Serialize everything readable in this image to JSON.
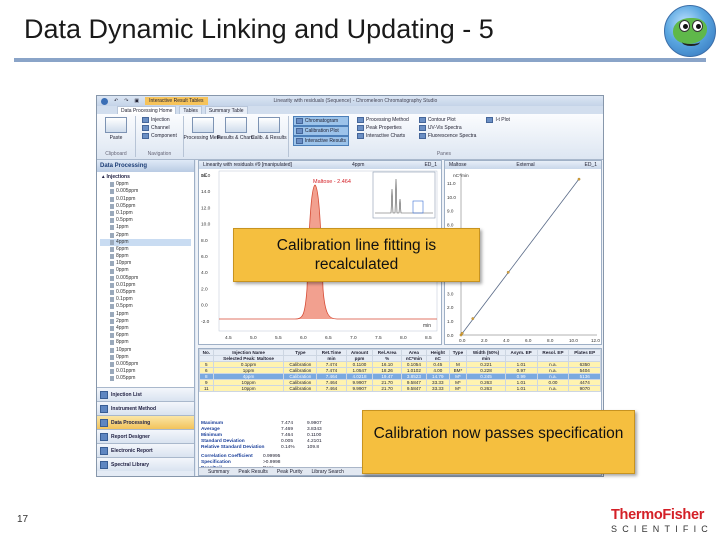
{
  "slide": {
    "title": "Data Dynamic Linking and Updating - 5",
    "number": "17",
    "accent_color": "#8aa4c8",
    "logo_line1": "ThermoFisher",
    "logo_line2": "SCIENTIFIC"
  },
  "callouts": {
    "one": "Calibration line fitting is recalculated",
    "two": "Calibration now passes specification"
  },
  "app": {
    "context_tab": "Interactive Result Tables",
    "window_title": "Linearity with residuals (Sequence) - Chromeleon Chromatography Studio",
    "tabs": [
      "Data Processing Home",
      "Tables",
      "Summary Table"
    ],
    "ribbon": {
      "clipboard_label": "Clipboard",
      "paste": "Paste",
      "navigation_label": "Navigation",
      "nav_items": [
        "Injection",
        "Channel",
        "Component"
      ],
      "panes_label": "Panes",
      "layouts": [
        "Processing Meth.",
        "Results & Charts",
        "Calib. & Results"
      ],
      "views": [
        "Chromatogram",
        "Calibration Plot",
        "Interactive Results"
      ],
      "views2": [
        "Processing Method",
        "Peak Properties",
        "Interactive Charts"
      ],
      "views3": [
        "Contour Plot",
        "UV-Vis Spectra",
        "Fluorescence Spectra"
      ],
      "views4": [
        "I-t Plot"
      ]
    },
    "sidebar": {
      "header": "Data Processing",
      "injections_label": "Injections",
      "injections": [
        "0ppm",
        "0.005ppm",
        "0.01ppm",
        "0.05ppm",
        "0.1ppm",
        "0.5ppm",
        "1ppm",
        "2ppm",
        "4ppm",
        "6ppm",
        "8ppm",
        "10ppm",
        "0ppm",
        "0.005ppm",
        "0.01ppm",
        "0.05ppm",
        "0.1ppm",
        "0.5ppm",
        "1ppm",
        "2ppm",
        "4ppm",
        "6ppm",
        "8ppm",
        "10ppm",
        "0ppm",
        "0.005ppm",
        "0.01ppm",
        "0.05ppm"
      ],
      "selected_index": 8,
      "nav_buttons": [
        "Injection List",
        "Instrument Method",
        "Data Processing",
        "Report Designer",
        "Electronic Report",
        "Spectral Library"
      ],
      "active_nav": 2
    },
    "chromatogram": {
      "title": "Linearity with residuals #9 [manipulated]",
      "injection": "4ppm",
      "channel": "ED_1",
      "unit": "nC",
      "peak_label": "Maltose - 2.464",
      "x_ticks": [
        "4.5",
        "5.0",
        "5.5",
        "6.0",
        "6.5",
        "7.0",
        "7.5",
        "8.0",
        "8.5"
      ],
      "y_ticks": [
        "16.0",
        "14.0",
        "12.0",
        "10.0",
        "8.0",
        "6.0",
        "4.0",
        "2.0",
        "0.0",
        "-2.0"
      ],
      "x_unit": "min"
    },
    "calibration": {
      "title": "Maltose",
      "mode": "External",
      "channel": "ED_1",
      "y_unit": "nC*min",
      "x_ticks": [
        "0.0",
        "2.0",
        "4.0",
        "6.0",
        "8.0",
        "10.0",
        "12.0"
      ],
      "y_ticks": [
        "11.0",
        "10.0",
        "9.0",
        "8.0",
        "7.0",
        "6.0",
        "5.0",
        "4.0",
        "3.0",
        "2.0",
        "1.0",
        "0.0"
      ]
    },
    "results": {
      "columns": [
        "No.",
        "Injection Name",
        "Type",
        "Ret.Time",
        "Amount",
        "Rel.Area",
        "Area",
        "Height",
        "Type",
        "Width (50%)",
        "Asym. EP",
        "Resol. EP",
        "Plates EP"
      ],
      "sub": [
        "",
        "Selected Peak: Maltose",
        "",
        "min",
        "ppm",
        "%",
        "nC*min",
        "nC",
        "",
        "min",
        "",
        "",
        ""
      ],
      "rows": [
        [
          "5",
          "0.1ppm",
          "Calibration",
          "7.474",
          "0.1100",
          "16.10",
          "0.1054",
          "0.45",
          "M",
          "0.221",
          "1.01",
          "n.a.",
          "6350"
        ],
        [
          "6",
          "1ppm",
          "Calibration",
          "7.474",
          "1.0547",
          "18.26",
          "1.0102",
          "4.00",
          "BM*",
          "0.228",
          "0.97",
          "n.a.",
          "5404"
        ],
        [
          "8",
          "4ppm",
          "Calibration",
          "7.464",
          "4.0218",
          "19.47",
          "3.8523",
          "14.79",
          "M*",
          "0.245",
          "0.99",
          "n.a.",
          "5136"
        ],
        [
          "9",
          "10ppm",
          "Calibration",
          "7.464",
          "9.9907",
          "21.70",
          "9.5847",
          "33.33",
          "M*",
          "0.263",
          "1.01",
          "0.00",
          "4474"
        ],
        [
          "11",
          "10ppm",
          "Calibration",
          "7.464",
          "9.9907",
          "21.70",
          "9.5847",
          "33.33",
          "M*",
          "0.263",
          "1.01",
          "n.a.",
          "9070"
        ]
      ],
      "stats_rows": [
        [
          "Maximum",
          "7.474",
          "9.9907"
        ],
        [
          "Average",
          "7.469",
          "3.8343"
        ],
        [
          "Minimum",
          "7.464",
          "0.1100"
        ],
        [
          "Standard Deviation",
          "0.005",
          "4.2101"
        ],
        [
          "Relative Standard Deviation",
          "0.14%",
          "109.8"
        ]
      ],
      "correlation_label": "Correlation Coefficient",
      "correlation_value": "0.99995",
      "spec_label": "Specification",
      "spec_value": ">0.9998",
      "pass_label": "Pass/Fail",
      "pass_value": "Pass",
      "sheet_tabs": [
        "Summary",
        "Peak Results",
        "Peak Purity",
        "Library Search"
      ]
    }
  }
}
